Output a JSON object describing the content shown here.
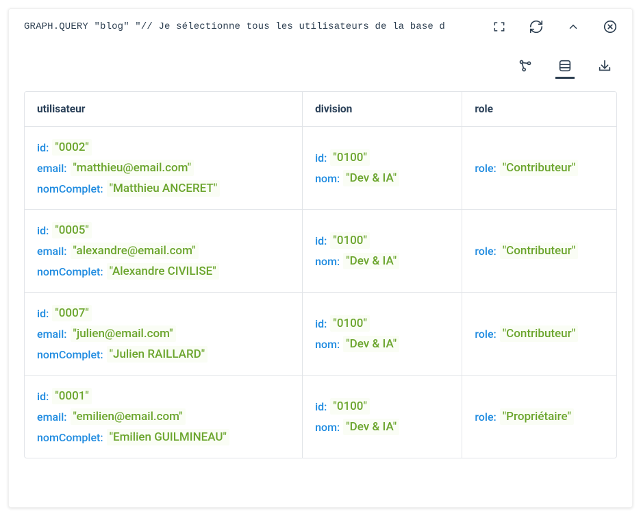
{
  "query": "GRAPH.QUERY \"blog\" \"// Je sélectionne tous les utilisateurs de la base d",
  "columns": [
    "utilisateur",
    "division",
    "role"
  ],
  "rows": [
    {
      "utilisateur": {
        "id": "0002",
        "email": "matthieu@email.com",
        "nomComplet": "Matthieu ANCERET"
      },
      "division": {
        "id": "0100",
        "nom": "Dev & IA"
      },
      "role": {
        "role": "Contributeur"
      }
    },
    {
      "utilisateur": {
        "id": "0005",
        "email": "alexandre@email.com",
        "nomComplet": "Alexandre CIVILISE"
      },
      "division": {
        "id": "0100",
        "nom": "Dev & IA"
      },
      "role": {
        "role": "Contributeur"
      }
    },
    {
      "utilisateur": {
        "id": "0007",
        "email": "julien@email.com",
        "nomComplet": "Julien RAILLARD"
      },
      "division": {
        "id": "0100",
        "nom": "Dev & IA"
      },
      "role": {
        "role": "Contributeur"
      }
    },
    {
      "utilisateur": {
        "id": "0001",
        "email": "emilien@email.com",
        "nomComplet": "Emilien GUILMINEAU"
      },
      "division": {
        "id": "0100",
        "nom": "Dev & IA"
      },
      "role": {
        "role": "Propriétaire"
      }
    }
  ]
}
